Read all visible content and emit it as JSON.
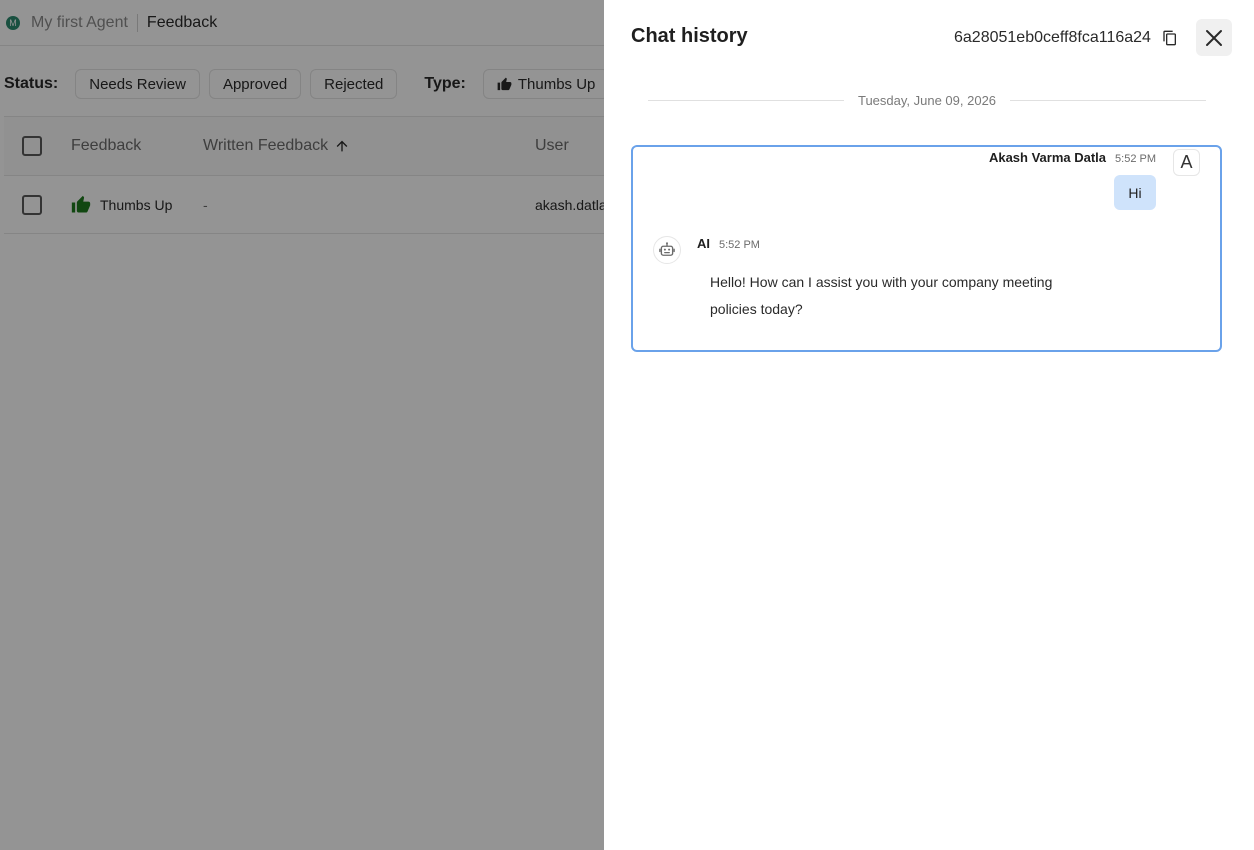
{
  "breadcrumb": {
    "agent_initial": "M",
    "agent_name": "My first Agent",
    "page": "Feedback"
  },
  "filters": {
    "status_label": "Status:",
    "status_options": [
      "Needs Review",
      "Approved",
      "Rejected"
    ],
    "type_label": "Type:",
    "type_options": [
      "Thumbs Up"
    ]
  },
  "table": {
    "columns": [
      "Feedback",
      "Written Feedback",
      "User"
    ],
    "rows": [
      {
        "feedback": "Thumbs Up",
        "written_feedback": "-",
        "user": "akash.datla"
      }
    ]
  },
  "drawer": {
    "title": "Chat history",
    "session_id": "6a28051eb0ceff8fca116a24",
    "date": "Tuesday, June 09, 2026",
    "messages": [
      {
        "sender": "Akash Varma Datla",
        "time": "5:52 PM",
        "text": "Hi",
        "avatar": "A"
      },
      {
        "sender": "AI",
        "time": "5:52 PM",
        "text": "Hello! How can I assist you with your company meeting policies today?"
      }
    ]
  },
  "colors": {
    "accent_border": "#6aa2ea",
    "user_bubble": "#cfe3fb",
    "thumbs_green": "#1e7a1e",
    "agent_badge": "#2b8a6e"
  },
  "icons": {
    "thumb": "thumbs-up-icon",
    "sort": "arrow-up-icon",
    "copy": "copy-icon",
    "close": "close-icon",
    "ai": "robot-icon"
  }
}
